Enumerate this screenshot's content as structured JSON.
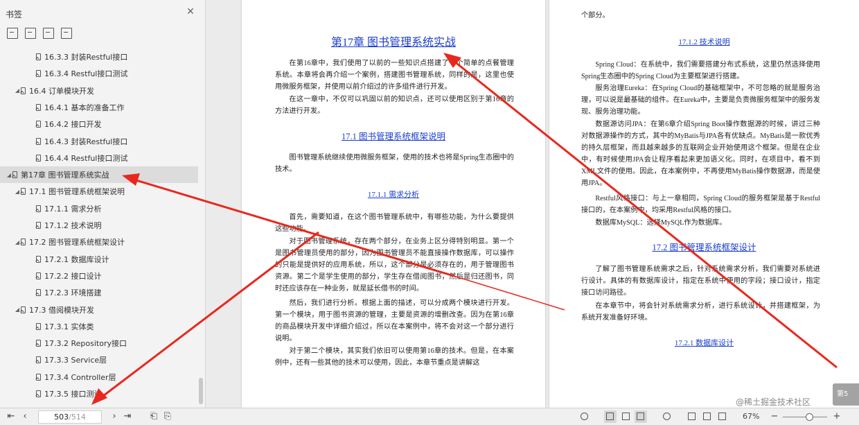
{
  "sidebar": {
    "title": "书签",
    "tree": [
      {
        "label": "16.3.3 封装Restful接口",
        "level": 3
      },
      {
        "label": "16.3.4 Restful接口测试",
        "level": 3
      },
      {
        "label": "16.4 订单模块开发",
        "level": 2,
        "expanded": true
      },
      {
        "label": "16.4.1 基本的准备工作",
        "level": 3
      },
      {
        "label": "16.4.2 接口开发",
        "level": 3
      },
      {
        "label": "16.4.3 封装Restful接口",
        "level": 3
      },
      {
        "label": "16.4.4 Restful接口测试",
        "level": 3
      },
      {
        "label": "第17章 图书管理系统实战",
        "level": 1,
        "expanded": true,
        "selected": true
      },
      {
        "label": "17.1 图书管理系统框架说明",
        "level": 2,
        "expanded": true
      },
      {
        "label": "17.1.1 需求分析",
        "level": 3
      },
      {
        "label": "17.1.2 技术说明",
        "level": 3
      },
      {
        "label": "17.2 图书管理系统框架设计",
        "level": 2,
        "expanded": true
      },
      {
        "label": "17.2.1 数据库设计",
        "level": 3
      },
      {
        "label": "17.2.2 接口设计",
        "level": 3
      },
      {
        "label": "17.2.3 环境搭建",
        "level": 3
      },
      {
        "label": "17.3 借阅模块开发",
        "level": 2,
        "expanded": true
      },
      {
        "label": "17.3.1 实体类",
        "level": 3
      },
      {
        "label": "17.3.2 Repository接口",
        "level": 3
      },
      {
        "label": "17.3.3 Service层",
        "level": 3
      },
      {
        "label": "17.3.4 Controller层",
        "level": 3
      },
      {
        "label": "17.3.5 接口测试",
        "level": 3
      }
    ]
  },
  "footer": {
    "current_page": "503",
    "total_pages": "/514",
    "zoom": "67%",
    "page_badge": "第5"
  },
  "watermark": "@稀土掘金技术社区",
  "page_left": {
    "chapter_title": "第17章  图书管理系统实战",
    "intro": [
      "在第16章中，我们使用了以前的一些知识点搭建了一个简单的点餐管理系统。本章将会再介绍一个案例，搭建图书管理系统，同样的是，这里也使用微服务框架，并使用以前介绍过的许多组件进行开发。",
      "在这一章中，不仅可以巩固以前的知识点，还可以使用区别于第16章的方法进行开发。"
    ],
    "section_17_1": "17.1  图书管理系统框架说明",
    "s17_1_text": "图书管理系统继续使用微服务框架，使用的技术也将是Spring生态圈中的技术。",
    "section_17_1_1": "17.1.1  需求分析",
    "s17_1_1_paras": [
      "首先，需要知道，在这个图书管理系统中，有哪些功能，为什么要提供这些功能。",
      "对于图书管理系统，存在两个部分，在业务上区分得特别明显。第一个是图书管理员使用的部分，因为图书管理员不能直接操作数据库，可以操作的只能是提供好的应用系统，所以，这个部分是必须存在的，用于管理图书资源。第二个是学生使用的部分，学生存在借阅图书，然后是归还图书，同时还应该存在一种业务，就是延长借书的时间。",
      "然后，我们进行分析。根据上面的描述，可以分成两个模块进行开发。第一个模块，用于图书资源的管理，主要是资源的增删改查。因为在第16章的商品模块开发中详细介绍过，所以在本案例中，将不会对这一个部分进行说明。",
      "对于第二个模块，其实我们依旧可以使用第16章的技术。但是，在本案例中，还有一些其他的技术可以使用，因此，本章节重点是讲解这"
    ]
  },
  "page_right": {
    "top_line": "个部分。",
    "section_17_1_2": "17.1.2  技术说明",
    "s17_1_2_paras": [
      "Spring Cloud：在系统中，我们需要搭建分布式系统，这里仍然选择使用Spring生态圈中的Spring Cloud为主要框架进行搭建。",
      "服务治理Eureka：在Spring Cloud的基础框架中，不可忽略的就是服务治理，可以说是最基础的组件。在Eureka中，主要是负责微服务框架中的服务发现、服务治理功能。",
      "数据源访问JPA：在第6章介绍Spring Boot操作数据源的时候，讲过三种对数据源操作的方式，其中的MyBatis与JPA各有优缺点。MyBatis是一款优秀的持久层框架，而且越来越多的互联网企业开始使用这个框架。但是在企业中，有时候使用JPA会让程序看起来更加语义化。同时，在项目中，看不到XML文件的使用。因此，在本案例中，不再使用MyBatis操作数据源，而是使用JPA。",
      "Restful风格接口：与上一章相同，Spring Cloud的服务框架是基于Restful接口的，在本案例中，均采用Restful风格的接口。",
      "数据库MySQL：选择MySQL作为数据库。"
    ],
    "section_17_2": "17.2  图书管理系统框架设计",
    "s17_2_paras": [
      "了解了图书管理系统需求之后，针对系统需求分析，我们需要对系统进行设计。具体的有数据库设计，指定在系统中使用的字段；接口设计，指定接口访问路径。",
      "在本章节中，将会针对系统需求分析，进行系统设计，并搭建框架，为系统开发准备好环境。"
    ],
    "section_17_2_1": "17.2.1  数据库设计"
  },
  "colors": {
    "arrow": "#e8281e",
    "heading_link": "#1a3dcc",
    "selected_row": "#dcdcdc"
  }
}
